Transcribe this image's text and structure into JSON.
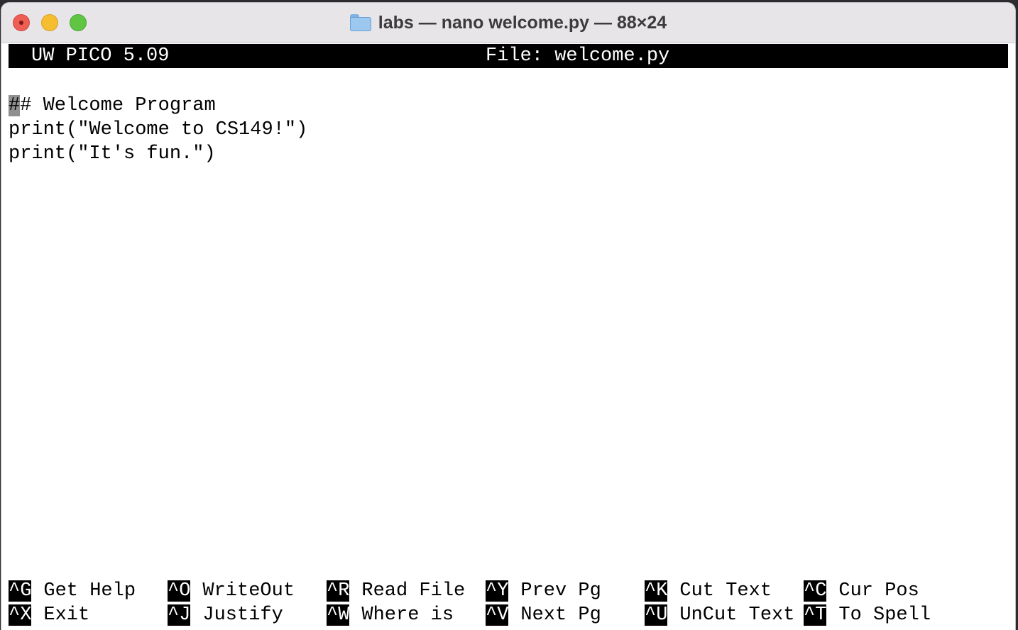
{
  "window": {
    "title": "labs — nano welcome.py — 88×24"
  },
  "header": {
    "app": "UW PICO 5.09",
    "file": "File: welcome.py"
  },
  "editor": {
    "cursor_char": "#",
    "lines": [
      "# Welcome Program",
      "print(\"Welcome to CS149!\")",
      "print(\"It's fun.\")"
    ]
  },
  "shortcuts": [
    {
      "key": "^G",
      "label": "Get Help"
    },
    {
      "key": "^O",
      "label": "WriteOut"
    },
    {
      "key": "^R",
      "label": "Read File"
    },
    {
      "key": "^Y",
      "label": "Prev Pg"
    },
    {
      "key": "^K",
      "label": "Cut Text"
    },
    {
      "key": "^C",
      "label": "Cur Pos"
    },
    {
      "key": "^X",
      "label": "Exit"
    },
    {
      "key": "^J",
      "label": "Justify"
    },
    {
      "key": "^W",
      "label": "Where is"
    },
    {
      "key": "^V",
      "label": "Next Pg"
    },
    {
      "key": "^U",
      "label": "UnCut Text"
    },
    {
      "key": "^T",
      "label": "To Spell"
    }
  ]
}
